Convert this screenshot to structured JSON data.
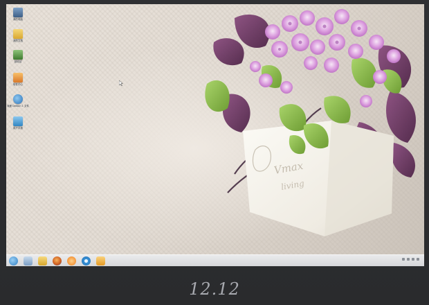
{
  "caption": "12.12",
  "desktop_icons": [
    {
      "name": "computer-icon",
      "label": "我的电脑",
      "color": "#5a7fa8"
    },
    {
      "name": "folder-icon",
      "label": "我的文档",
      "color": "#e9c24e"
    },
    {
      "name": "recycle-bin-icon",
      "label": "回收站",
      "color": "#5e9b4a"
    },
    {
      "name": "software-center-icon",
      "label": "软件中心",
      "color": "#e79b3a"
    },
    {
      "name": "deepin-logo-icon",
      "label": "深度 Deepin 1 文件",
      "color": "#3b87c9"
    },
    {
      "name": "user-guide-icon",
      "label": "用户手册",
      "color": "#4ea3dc"
    }
  ],
  "taskbar": {
    "apps": [
      {
        "name": "start-menu-icon",
        "color": "#3a8bd0"
      },
      {
        "name": "file-manager-icon",
        "color": "#8fb1d6"
      },
      {
        "name": "folder-taskbar-icon",
        "color": "#e9c24e"
      },
      {
        "name": "firefox-icon",
        "color": "#e2732a"
      },
      {
        "name": "music-player-icon",
        "color": "#f08a20"
      },
      {
        "name": "browser-icon",
        "color": "#3a93d8"
      },
      {
        "name": "software-center-taskbar-icon",
        "color": "#f2b33d"
      }
    ],
    "clock": ""
  },
  "colors": {
    "frame": "#2d2e30",
    "caption": "#a8aab0",
    "petal": "#d58ad8",
    "leaf": "#86b548",
    "purple_leaf": "#6e3a66",
    "vase": "#f4f1ea"
  }
}
